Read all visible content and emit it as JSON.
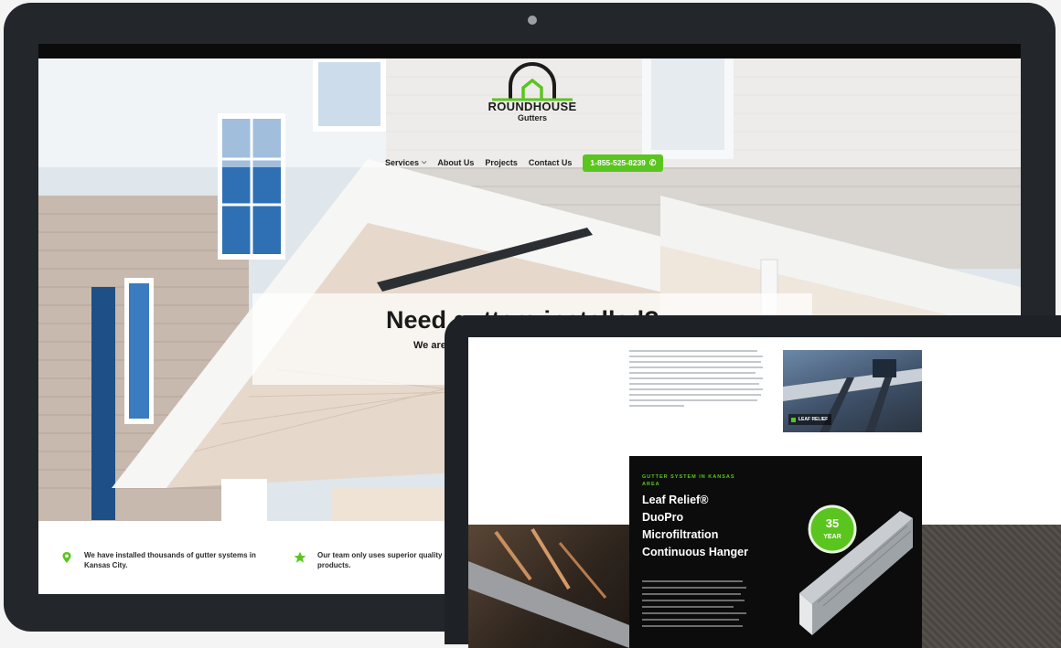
{
  "site": {
    "logo": {
      "name": "ROUNDHOUSE",
      "sub": "Gutters"
    },
    "nav": [
      {
        "label": "Services",
        "has_dropdown": true
      },
      {
        "label": "About Us",
        "has_dropdown": false
      },
      {
        "label": "Projects",
        "has_dropdown": false
      },
      {
        "label": "Contact Us",
        "has_dropdown": false
      }
    ],
    "phone_button": {
      "label": "1-855-525-8239",
      "icon": "phone-icon"
    },
    "hero": {
      "title": "Need gutters installed?",
      "subtitle": "We are"
    },
    "features": [
      {
        "icon": "map-pin-icon",
        "text": "We have installed thousands of gutter systems in Kansas City."
      },
      {
        "icon": "star-icon",
        "text": "Our team only uses superior quality products."
      }
    ]
  },
  "laptop_page": {
    "thumb_caption": "LEAF RELIEF",
    "eyebrow": "GUTTER SYSTEM IN KANSAS AREA",
    "product_title_lines": [
      "Leaf Relief®",
      "DuoPro",
      "Microfiltration",
      "Continuous Hanger"
    ],
    "badge_number": "35",
    "badge_text": "YEAR"
  },
  "colors": {
    "accent_green": "#5bc51f",
    "monitor_bezel": "#23272c",
    "dark_card": "#0c0c0c"
  }
}
